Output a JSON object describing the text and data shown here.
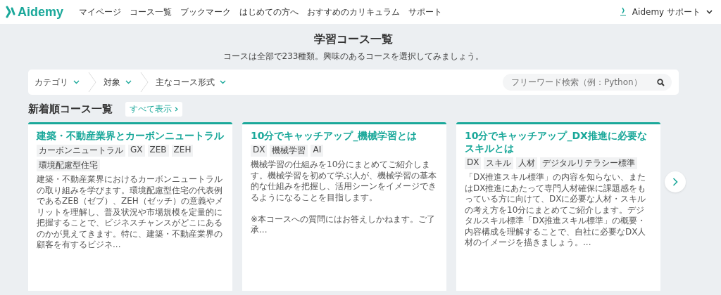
{
  "header": {
    "logo": "Aidemy",
    "nav": [
      "マイページ",
      "コース一覧",
      "ブックマーク",
      "はじめての方へ",
      "おすすめのカリキュラム",
      "サポート"
    ],
    "account": "Aidemy サポート"
  },
  "hero": {
    "title": "学習コース一覧",
    "subtitle": "コースは全部で233種類。興味のあるコースを選択してみましょう。"
  },
  "filters": [
    {
      "label": "カテゴリ"
    },
    {
      "label": "対象"
    },
    {
      "label": "主なコース形式"
    }
  ],
  "search": {
    "placeholder": "フリーワード検索（例：Python）"
  },
  "section": {
    "title": "新着順コース一覧",
    "link": "すべて表示"
  },
  "courses": [
    {
      "title": "建築・不動産業界とカーボンニュートラル",
      "tags": [
        "カーボンニュートラル",
        "GX",
        "ZEB",
        "ZEH",
        "環境配慮型住宅"
      ],
      "description": "建築・不動産業界におけるカーボンニュートラルの取り組みを学びます。環境配慮型住宅の代表例であるZEB（ゼブ）、ZEH（ゼッチ）の意義やメリットを理解し、普及状況や市場規模を定量的に把握することで、ビジネスチャンスがどこにあるのかが見えてきます。特に、建築・不動産業界の顧客を有するビジネ..."
    },
    {
      "title": "10分でキャッチアップ_機械学習とは",
      "tags": [
        "DX",
        "機械学習",
        "AI"
      ],
      "description": "機械学習の仕組みを10分にまとめてご紹介します。機械学習を初めて学ぶ人が、機械学習の基本的な仕組みを把握し、活用シーンをイメージできるようになることを目指します。\n\n※本コースへの質問にはお答えしかねます。ご了承..."
    },
    {
      "title": "10分でキャッチアップ_DX推進に必要なスキルとは",
      "tags": [
        "DX",
        "スキル",
        "人材",
        "デジタルリテラシー標準"
      ],
      "description": "「DX推進スキル標準」の内容を知らない、またはDX推進にあたって専門人材確保に課題感をもっている方に向けて、DXに必要な人材・スキルの考え方を10分にまとめてご紹介します。デジタルスキル標準「DX推進スキル標準」の概要・内容構成を理解することで、自社に必要なDX人材のイメージを描きましょう。..."
    }
  ]
}
